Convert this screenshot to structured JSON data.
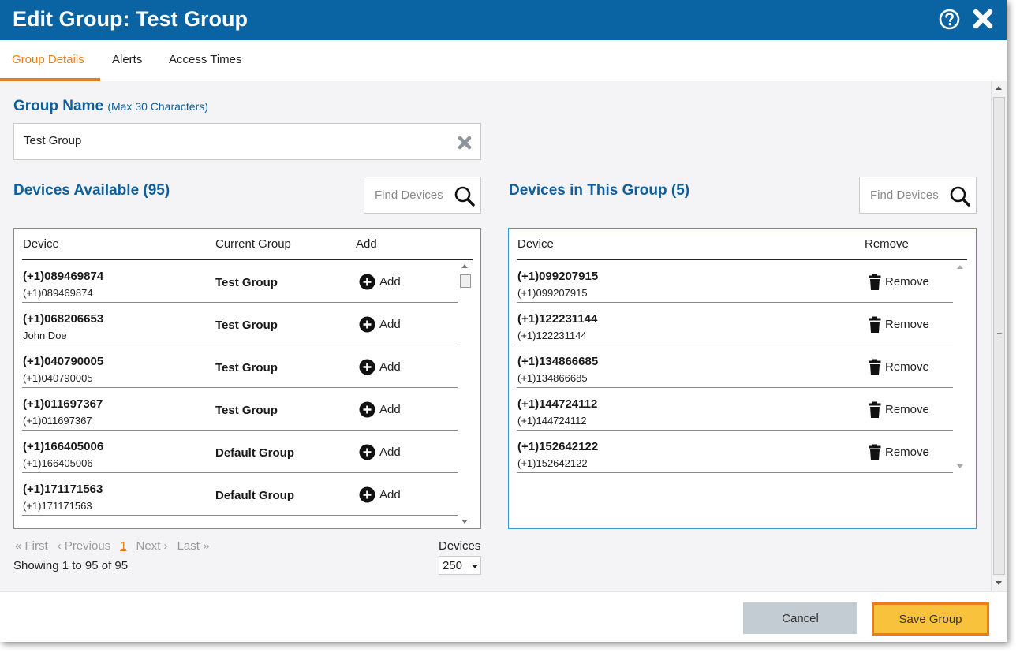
{
  "dialog": {
    "title": "Edit Group: Test Group"
  },
  "tabs": [
    {
      "label": "Group Details",
      "active": true
    },
    {
      "label": "Alerts",
      "active": false
    },
    {
      "label": "Access Times",
      "active": false
    }
  ],
  "group_name": {
    "label": "Group Name",
    "hint": "(Max 30 Characters)",
    "value": "Test Group"
  },
  "available": {
    "heading": "Devices Available (95)",
    "search_placeholder": "Find Devices",
    "columns": {
      "device": "Device",
      "group": "Current Group",
      "add": "Add"
    },
    "action_label": "Add",
    "rows": [
      {
        "number": "(+1)089469874",
        "name": "(+1)089469874",
        "group": "Test Group"
      },
      {
        "number": "(+1)068206653",
        "name": "John Doe",
        "group": "Test Group"
      },
      {
        "number": "(+1)040790005",
        "name": "(+1)040790005",
        "group": "Test Group"
      },
      {
        "number": "(+1)011697367",
        "name": "(+1)011697367",
        "group": "Test Group"
      },
      {
        "number": "(+1)166405006",
        "name": "(+1)166405006",
        "group": "Default Group"
      },
      {
        "number": "(+1)171171563",
        "name": "(+1)171171563",
        "group": "Default Group"
      }
    ]
  },
  "in_group": {
    "heading": "Devices in This Group (5)",
    "search_placeholder": "Find Devices",
    "columns": {
      "device": "Device",
      "remove": "Remove"
    },
    "action_label": "Remove",
    "rows": [
      {
        "number": "(+1)099207915",
        "name": "(+1)099207915"
      },
      {
        "number": "(+1)122231144",
        "name": "(+1)122231144"
      },
      {
        "number": "(+1)134866685",
        "name": "(+1)134866685"
      },
      {
        "number": "(+1)144724112",
        "name": "(+1)144724112"
      },
      {
        "number": "(+1)152642122",
        "name": "(+1)152642122"
      }
    ]
  },
  "pagination": {
    "first": "« First",
    "previous": "‹ Previous",
    "current": "1",
    "next": "Next ›",
    "last": "Last »",
    "showing": "Showing 1 to 95 of 95",
    "per_page_label": "Devices",
    "per_page_value": "250"
  },
  "footer": {
    "cancel_label": "Cancel",
    "save_label": "Save Group"
  },
  "colors": {
    "header_bg": "#0a64a4",
    "accent": "#e57f1b",
    "heading_blue": "#0e5f9b",
    "save_bg": "#f9c23c",
    "save_border": "#f07a14"
  },
  "icons": {
    "help": "question-circle-icon",
    "close": "close-x-icon",
    "clear": "clear-x-icon",
    "search": "magnifier-icon",
    "add": "plus-circle-icon",
    "remove": "trash-icon"
  }
}
